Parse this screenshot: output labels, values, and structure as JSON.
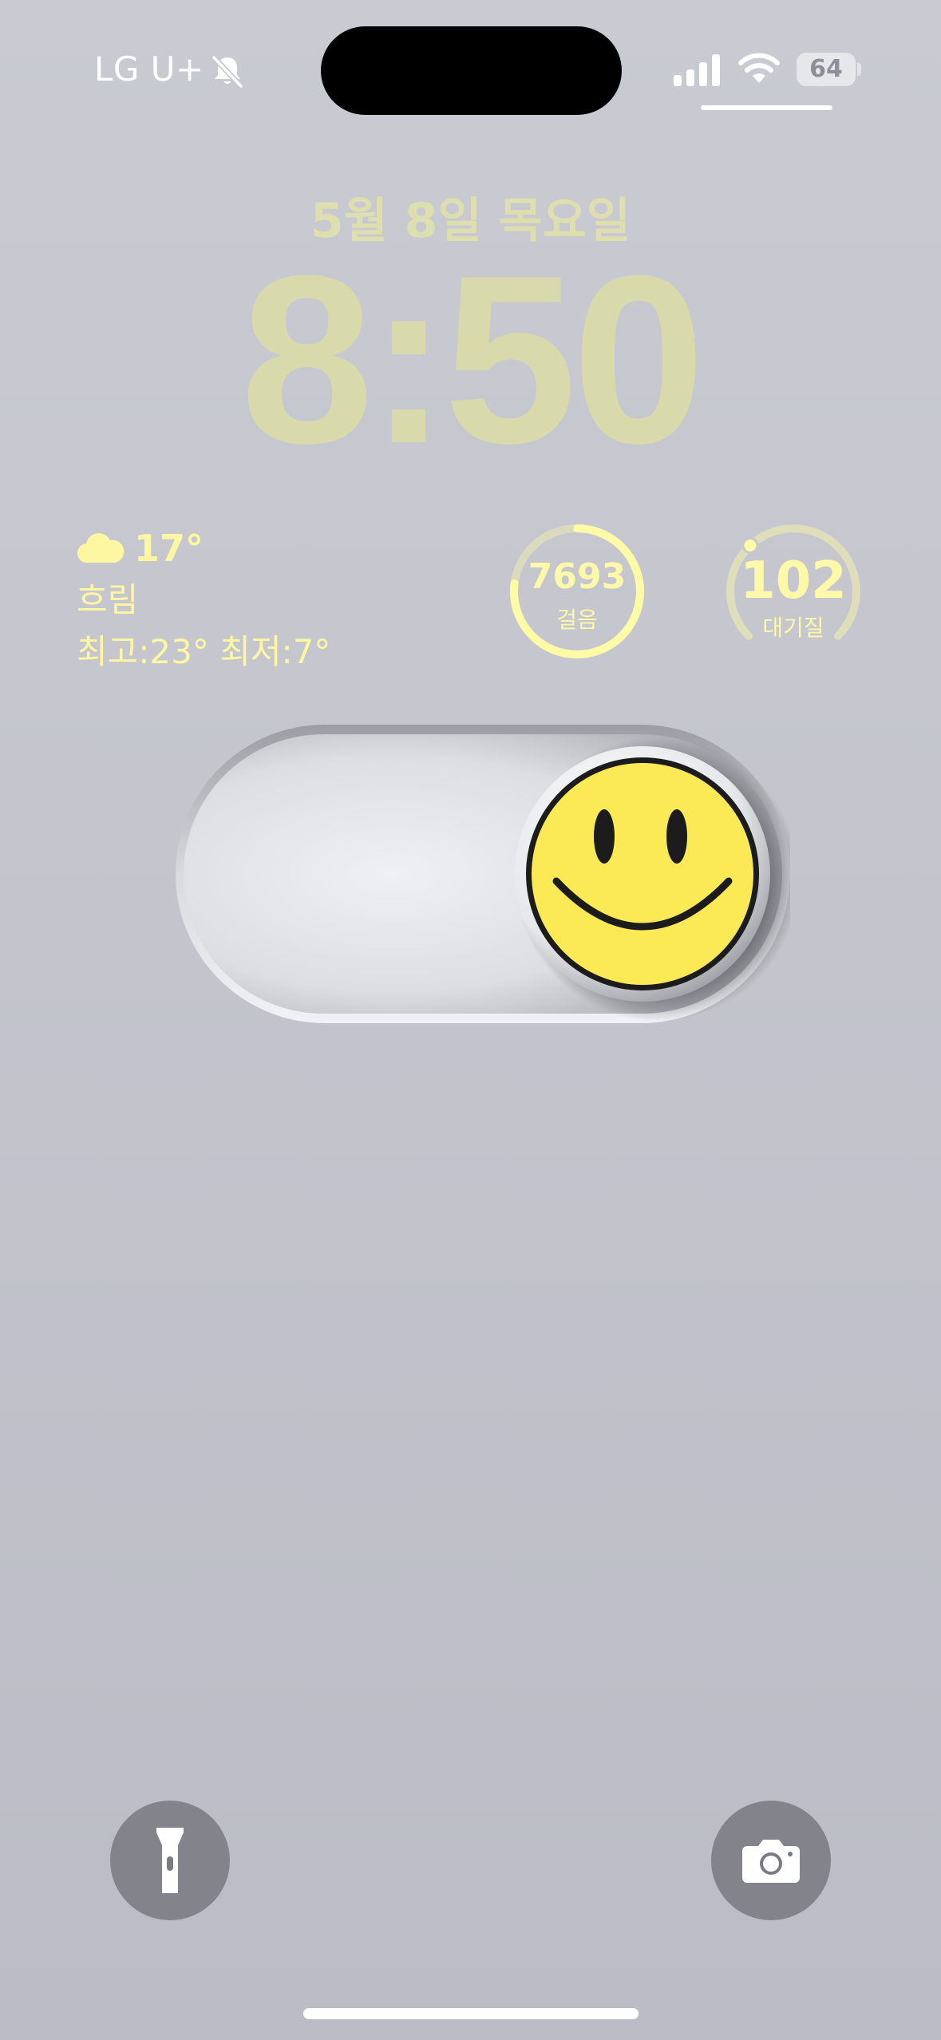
{
  "status_bar": {
    "carrier": "LG U+",
    "battery": "64",
    "icons": [
      "bell-slash-icon",
      "signal-icon",
      "wifi-icon",
      "battery-icon"
    ]
  },
  "lock_screen": {
    "date": "5월 8일 목요일",
    "time": "8:50"
  },
  "weather": {
    "icon": "cloud-icon",
    "temp": "17°",
    "condition": "흐림",
    "range": "최고:23° 최저:7°"
  },
  "steps": {
    "value": "7693",
    "label": "걸음",
    "progress": 0.77
  },
  "air_quality": {
    "value": "102",
    "label": "대기질",
    "level": 0.34
  },
  "bottom": {
    "left_button": "flashlight-icon",
    "right_button": "camera-icon"
  },
  "colors": {
    "widget_yellow": "#fdf9a8",
    "clock": "#d9daab",
    "background": "#c6c7cf",
    "smiley": "#fbe955"
  }
}
